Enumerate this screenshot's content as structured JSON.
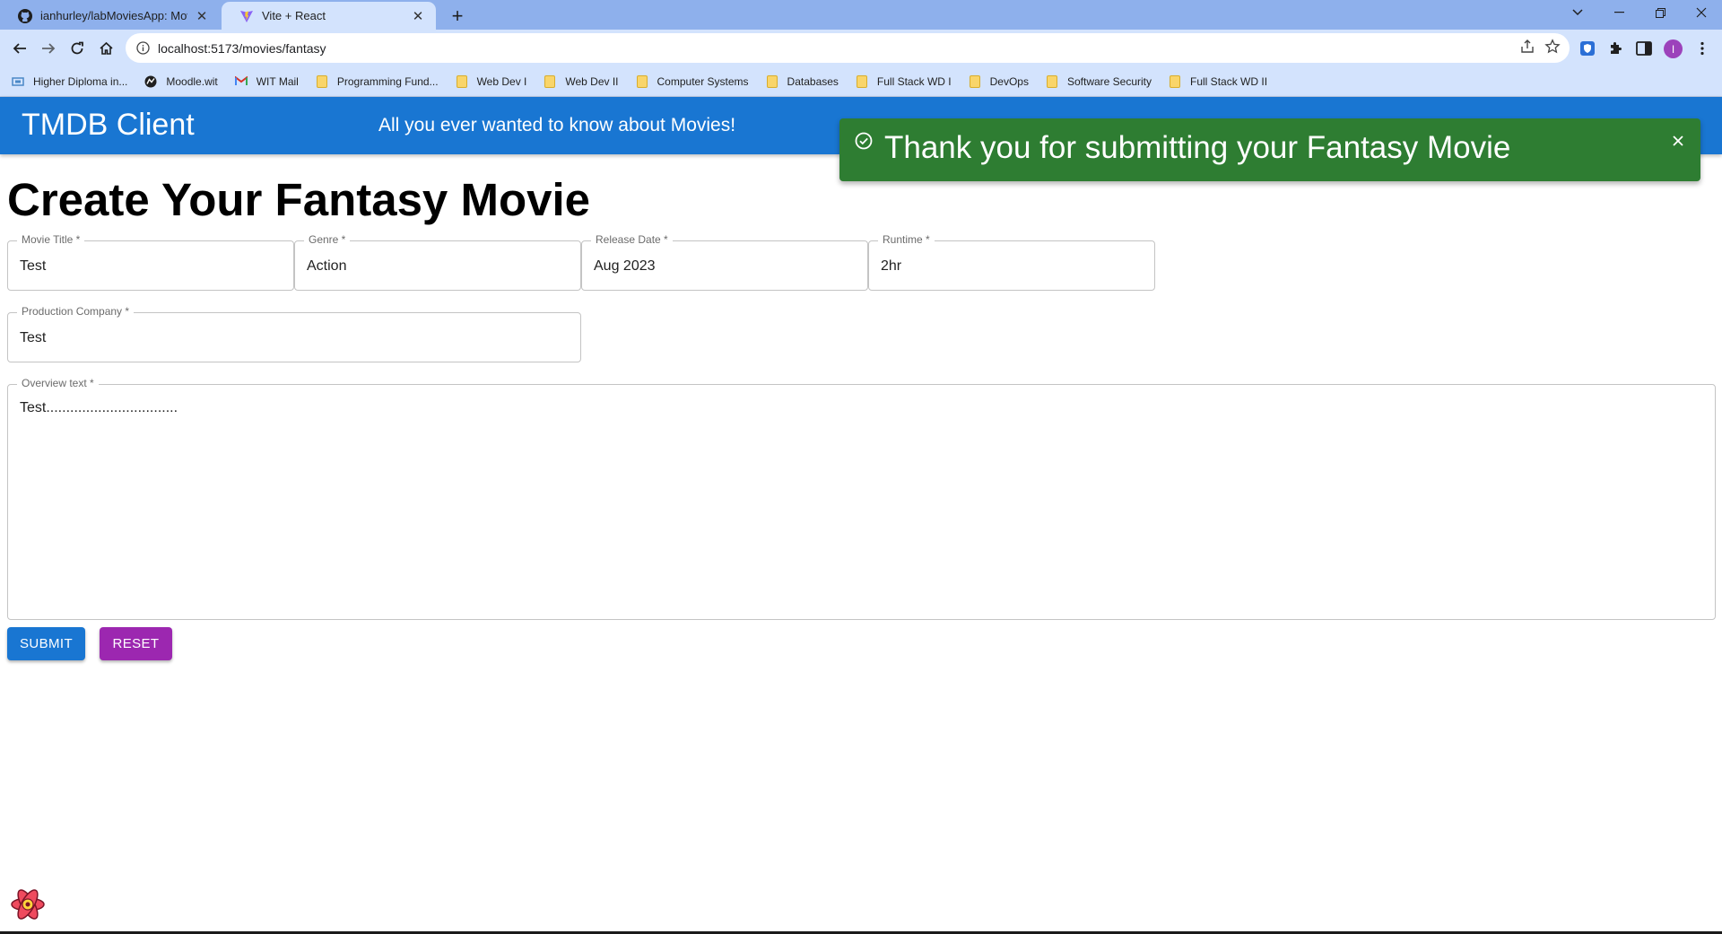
{
  "browser": {
    "tabs": [
      {
        "title": "ianhurley/labMoviesApp: Movie",
        "icon": "github-icon",
        "active": false
      },
      {
        "title": "Vite + React",
        "icon": "vite-icon",
        "active": true
      }
    ],
    "address_bar": {
      "url": "localhost:5173/movies/fantasy"
    },
    "profile_initial": "I",
    "bookmarks": [
      {
        "label": "Higher Diploma in...",
        "icon": "site-icon"
      },
      {
        "label": "Moodle.wit",
        "icon": "moodle-icon"
      },
      {
        "label": "WIT Mail",
        "icon": "gmail-icon"
      },
      {
        "label": "Programming Fund...",
        "icon": "folder-icon"
      },
      {
        "label": "Web Dev I",
        "icon": "folder-icon"
      },
      {
        "label": "Web Dev II",
        "icon": "folder-icon"
      },
      {
        "label": "Computer Systems",
        "icon": "folder-icon"
      },
      {
        "label": "Databases",
        "icon": "folder-icon"
      },
      {
        "label": "Full Stack WD I",
        "icon": "folder-icon"
      },
      {
        "label": "DevOps",
        "icon": "folder-icon"
      },
      {
        "label": "Software Security",
        "icon": "folder-icon"
      },
      {
        "label": "Full Stack WD II",
        "icon": "folder-icon"
      }
    ]
  },
  "app": {
    "title": "TMDB Client",
    "subtitle": "All you ever wanted to know about Movies!",
    "primary_color": "#1976d2"
  },
  "toast": {
    "message": "Thank you for submitting your Fantasy Movie",
    "color": "#2e7d32"
  },
  "form": {
    "heading": "Create Your Fantasy Movie",
    "fields": {
      "title": {
        "label": "Movie Title *",
        "value": "Test"
      },
      "genre": {
        "label": "Genre *",
        "value": "Action"
      },
      "release_date": {
        "label": "Release Date *",
        "value": "Aug 2023"
      },
      "runtime": {
        "label": "Runtime *",
        "value": "2hr"
      },
      "production_company": {
        "label": "Production Company *",
        "value": "Test"
      },
      "overview": {
        "label": "Overview text *",
        "value": "Test................................."
      }
    },
    "buttons": {
      "submit": {
        "label": "SUBMIT",
        "color": "#1976d2"
      },
      "reset": {
        "label": "RESET",
        "color": "#9c27b0"
      }
    }
  }
}
